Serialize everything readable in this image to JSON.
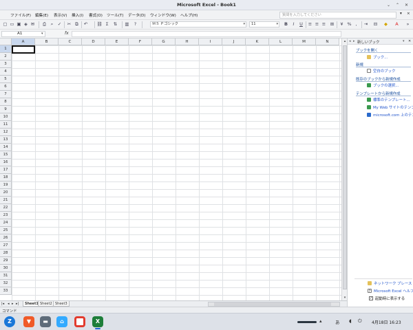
{
  "window": {
    "title": "Microsoft Excel - Book1"
  },
  "menubar": {
    "items": [
      "ファイル(F)",
      "編集(E)",
      "表示(V)",
      "挿入(I)",
      "書式(O)",
      "ツール(T)",
      "データ(D)",
      "ウィンドウ(W)",
      "ヘルプ(H)"
    ],
    "help_placeholder": "質問を入力してください"
  },
  "toolbar": {
    "font_name": "ＭＳ Ｐゴシック",
    "font_size": "11",
    "bold": "B",
    "italic": "I",
    "underline": "U",
    "percent": "%",
    "comma": ","
  },
  "formula_bar": {
    "name_box": "A1",
    "fx_label": "fx",
    "value": ""
  },
  "grid": {
    "columns": [
      "A",
      "B",
      "C",
      "D",
      "E",
      "F",
      "G",
      "H",
      "I",
      "J",
      "K",
      "L",
      "M",
      "N"
    ],
    "rows": [
      "1",
      "2",
      "3",
      "4",
      "5",
      "6",
      "7",
      "8",
      "9",
      "10",
      "11",
      "12",
      "13",
      "14",
      "15",
      "16",
      "17",
      "18",
      "19",
      "20",
      "21",
      "22",
      "23",
      "24",
      "25",
      "26",
      "27",
      "28",
      "29",
      "30",
      "31",
      "32",
      "33"
    ],
    "active_cell": "A1"
  },
  "sheet_tabs": [
    "Sheet1",
    "Sheet2",
    "Sheet3"
  ],
  "statusbar": {
    "text": "コマンド"
  },
  "task_pane": {
    "title": "新しいブック",
    "sections": {
      "open_book": {
        "heading": "ブックを開く",
        "link": "ブック..."
      },
      "new": {
        "heading": "新規",
        "link": "空白のブック"
      },
      "from_existing": {
        "heading": "既存のブックから新規作成",
        "link": "ブックの選択..."
      },
      "from_template": {
        "heading": "テンプレートから新規作成",
        "links": [
          "標準のテンプレート...",
          "My Web サイトのテンプ",
          "microsoft.com 上のテン"
        ]
      }
    },
    "bottom": {
      "network": "ネットワーク プレース",
      "help": "Microsoft Excel ヘルプ",
      "show_at_startup": "起動時に表示する"
    }
  },
  "taskbar": {
    "ime": "あ",
    "clock": "4月18日  16:23"
  }
}
